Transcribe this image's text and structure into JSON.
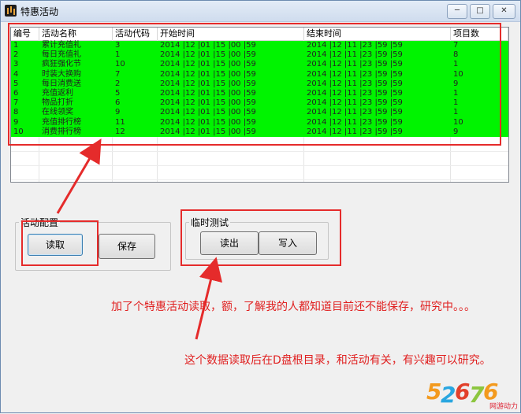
{
  "window": {
    "title": "特惠活动",
    "controls": [
      "─",
      "□",
      "✕"
    ]
  },
  "list": {
    "columns": [
      "编号",
      "活动名称",
      "活动代码",
      "开始时间",
      "结束时间",
      "项目数"
    ],
    "rows": [
      [
        "1",
        "累计充值礼",
        "3",
        "2014 |12 |01 |15 |00 |59",
        "2014 |12 |11 |23 |59 |59",
        "7"
      ],
      [
        "2",
        "每日充值礼",
        "1",
        "2014 |12 |01 |15 |00 |59",
        "2014 |12 |11 |23 |59 |59",
        "8"
      ],
      [
        "3",
        "疯狂强化节",
        "10",
        "2014 |12 |01 |15 |00 |59",
        "2014 |12 |11 |23 |59 |59",
        "1"
      ],
      [
        "4",
        "时装大换购",
        "7",
        "2014 |12 |01 |15 |00 |59",
        "2014 |12 |11 |23 |59 |59",
        "10"
      ],
      [
        "5",
        "每日消费送",
        "2",
        "2014 |12 |01 |15 |00 |59",
        "2014 |12 |11 |23 |59 |59",
        "9"
      ],
      [
        "6",
        "充值返利",
        "5",
        "2014 |12 |01 |15 |00 |59",
        "2014 |12 |11 |23 |59 |59",
        "1"
      ],
      [
        "7",
        "物品打折",
        "6",
        "2014 |12 |01 |15 |00 |59",
        "2014 |12 |11 |23 |59 |59",
        "1"
      ],
      [
        "8",
        "在线领奖",
        "9",
        "2014 |12 |01 |15 |00 |59",
        "2014 |12 |11 |23 |59 |59",
        "1"
      ],
      [
        "9",
        "充值排行榜",
        "11",
        "2014 |12 |01 |15 |00 |59",
        "2014 |12 |11 |23 |59 |59",
        "10"
      ],
      [
        "10",
        "消费排行榜",
        "12",
        "2014 |12 |01 |15 |00 |59",
        "2014 |12 |11 |23 |59 |59",
        "9"
      ]
    ]
  },
  "activity_config": {
    "label": "活动配置",
    "read_button": "读取",
    "save_button": "保存"
  },
  "temp_test": {
    "label": "临时测试",
    "export_button": "读出",
    "write_button": "写入"
  },
  "annotations": {
    "note1": "加了个特惠活动读取，额，了解我的人都知道目前还不能保存，研究中。。。",
    "note2": "这个数据读取后在D盘根目录，和活动有关，有兴趣可以研究。"
  },
  "watermark": {
    "digits": [
      "5",
      "2",
      "6",
      "7",
      "6"
    ],
    "sub": "网游动力"
  },
  "colors": {
    "selected_row": "#00f400",
    "highlight": "#e52b2b"
  }
}
